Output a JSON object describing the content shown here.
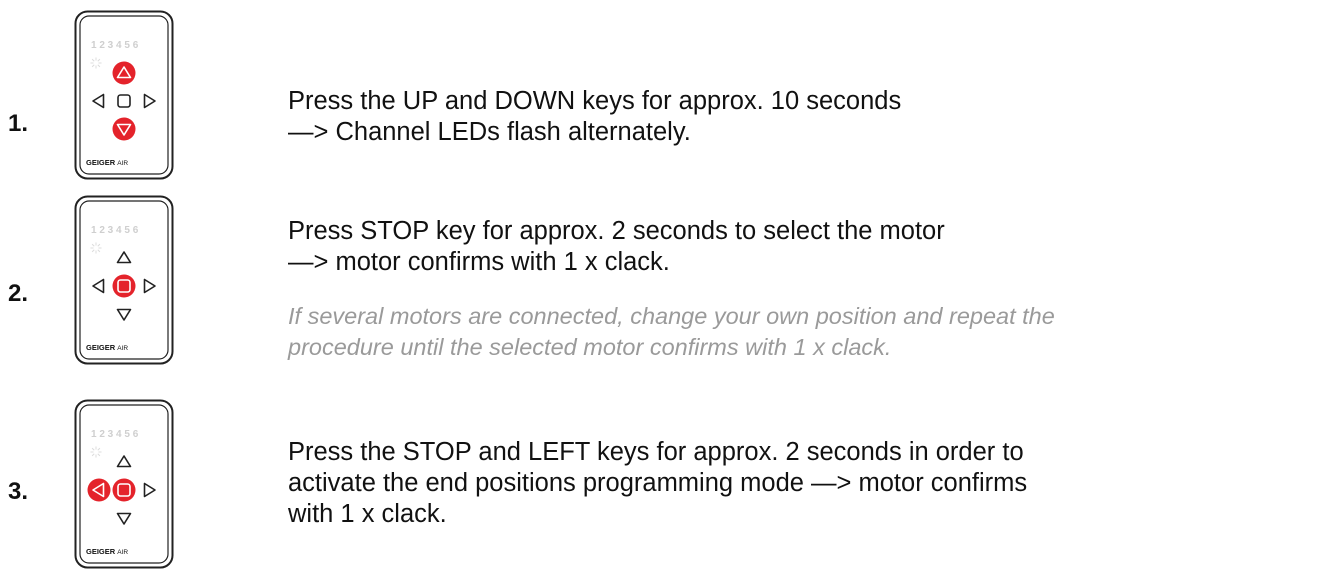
{
  "brand": {
    "name": "GEIGER",
    "suffix": "AIR"
  },
  "channels": "1 2 3 4 5 6",
  "colors": {
    "active_key": "#e4232b",
    "frame": "#222222",
    "channels": "#cfcfcf"
  },
  "steps": [
    {
      "number": "1.",
      "active_keys": [
        "up",
        "down"
      ],
      "lines": [
        "Press the UP and DOWN keys for approx. 10 seconds",
        "—> Channel LEDs flash alternately."
      ],
      "note_lines": []
    },
    {
      "number": "2.",
      "active_keys": [
        "stop"
      ],
      "lines": [
        "Press STOP key for approx. 2 seconds to select the motor",
        "—> motor confirms with 1 x clack."
      ],
      "note_lines": [
        "If several motors are connected, change your own position and repeat the",
        "procedure until the selected motor confirms with 1 x clack."
      ]
    },
    {
      "number": "3.",
      "active_keys": [
        "left",
        "stop"
      ],
      "lines": [
        "Press the STOP and LEFT keys for approx. 2 seconds in order to",
        "activate the end positions programming mode —> motor confirms",
        "with 1 x clack."
      ],
      "note_lines": []
    }
  ]
}
